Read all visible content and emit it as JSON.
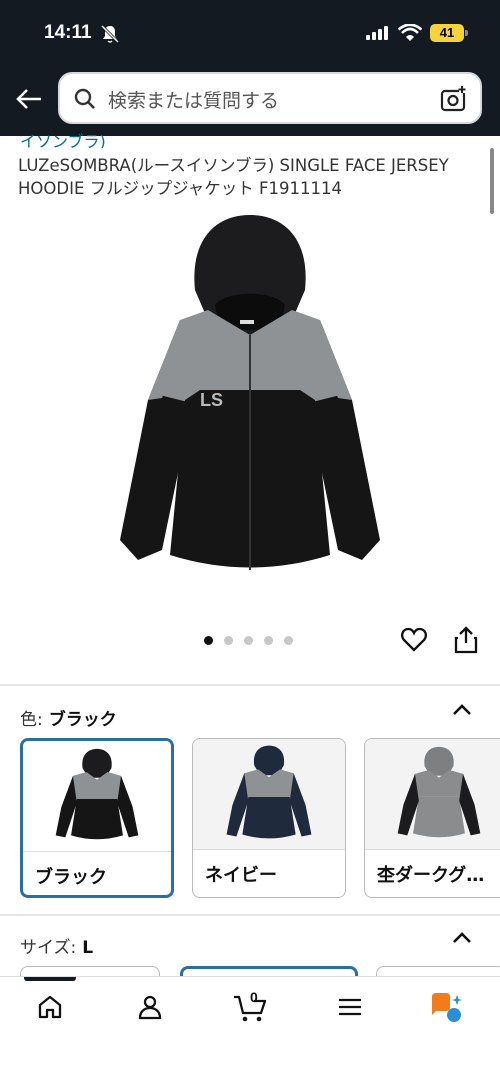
{
  "status_bar": {
    "time": "14:11",
    "battery": "41"
  },
  "search": {
    "placeholder": "検索または質問する"
  },
  "product": {
    "brand_partial": "イソンブラ)",
    "title": "LUZeSOMBRA(ルースイソンブラ) SINGLE FACE JERSEY HOODIE フルジップジャケット F1911114",
    "image_count": 5,
    "active_image": 0
  },
  "color": {
    "label": "色:",
    "selected": "ブラック",
    "options": [
      {
        "label": "ブラック",
        "selected": true
      },
      {
        "label": "ネイビー",
        "selected": false
      },
      {
        "label": "杢ダークグ…",
        "selected": false
      }
    ]
  },
  "size": {
    "label": "サイズ:",
    "selected": "L"
  },
  "cart": {
    "count": "0"
  },
  "colors": {
    "header_bg": "#131a22",
    "selected_border": "#2a6ea6",
    "link": "#007185",
    "battery": "#f5d33a"
  },
  "icons": [
    "back-arrow-icon",
    "search-icon",
    "camera-icon",
    "heart-icon",
    "share-icon",
    "home-icon",
    "account-icon",
    "cart-icon",
    "menu-icon",
    "ai-assistant-icon"
  ]
}
